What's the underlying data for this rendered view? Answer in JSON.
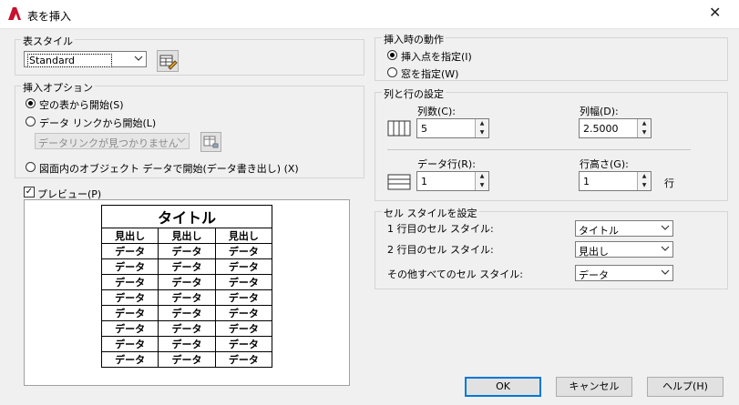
{
  "window": {
    "title": "表を挿入"
  },
  "table_style": {
    "group_label": "表スタイル",
    "value": "Standard"
  },
  "insert_options": {
    "group_label": "挿入オプション",
    "opt_empty": "空の表から開始(S)",
    "opt_datalink": "データ リンクから開始(L)",
    "datalink_combo": "データリンクが見つかりません",
    "opt_drawing": "図面内のオブジェクト データで開始(データ書き出し) (X)",
    "selected": "opt_empty"
  },
  "preview": {
    "checkbox_label": "プレビュー(P)",
    "checked": true,
    "title": "タイトル",
    "headers": [
      "見出し",
      "見出し",
      "見出し"
    ],
    "data_cell": "データ",
    "data_rows": 8
  },
  "insertion_behavior": {
    "group_label": "挿入時の動作",
    "opt_point": "挿入点を指定(I)",
    "opt_window": "窓を指定(W)",
    "selected": "opt_point"
  },
  "columns_rows": {
    "group_label": "列と行の設定",
    "columns_label": "列数(C):",
    "columns_value": "5",
    "column_width_label": "列幅(D):",
    "column_width_value": "2.5000",
    "data_rows_label": "データ行(R):",
    "data_rows_value": "1",
    "row_height_label": "行高さ(G):",
    "row_height_value": "1",
    "row_unit": "行"
  },
  "cell_styles": {
    "group_label": "セル スタイルを設定",
    "first_row_label": "1 行目のセル スタイル:",
    "first_row_value": "タイトル",
    "second_row_label": "2 行目のセル スタイル:",
    "second_row_value": "見出し",
    "other_rows_label": "その他すべてのセル スタイル:",
    "other_rows_value": "データ"
  },
  "buttons": {
    "ok": "OK",
    "cancel": "キャンセル",
    "help": "ヘルプ(H)"
  },
  "colors": {
    "brand_red": "#c8102e",
    "focus_blue": "#0078d7"
  }
}
